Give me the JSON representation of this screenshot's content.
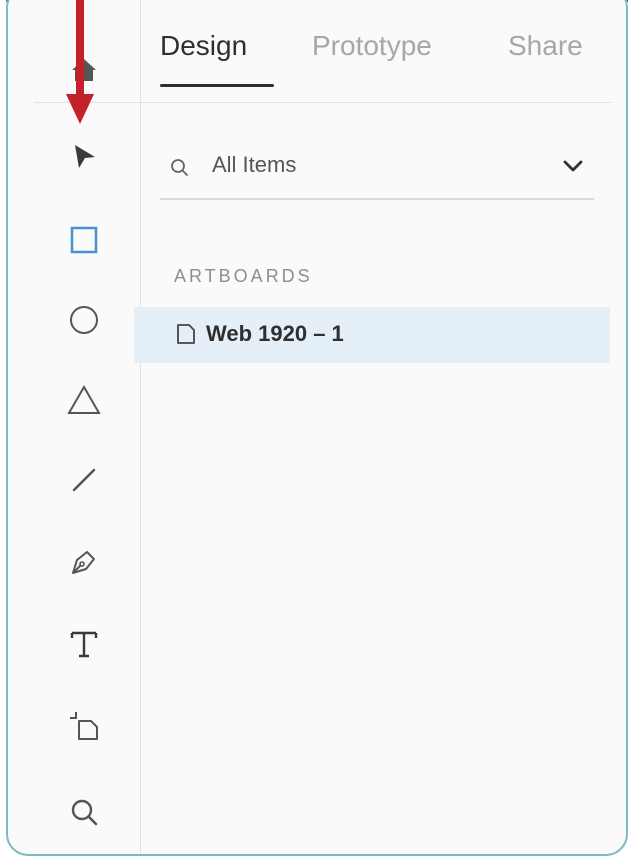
{
  "tabs": [
    {
      "label": "Design",
      "active": true
    },
    {
      "label": "Prototype",
      "active": false
    },
    {
      "label": "Share",
      "active": false
    }
  ],
  "search": {
    "label": "All Items"
  },
  "section": {
    "header": "ARTBOARDS"
  },
  "artboards": [
    {
      "label": "Web 1920 – 1",
      "selected": true
    }
  ],
  "tools": [
    {
      "icon": "select-arrow-icon",
      "selected": true
    },
    {
      "icon": "rectangle-icon",
      "selected": false
    },
    {
      "icon": "ellipse-icon",
      "selected": false
    },
    {
      "icon": "polygon-icon",
      "selected": false
    },
    {
      "icon": "line-icon",
      "selected": false
    },
    {
      "icon": "pen-icon",
      "selected": false
    },
    {
      "icon": "text-icon",
      "selected": false
    },
    {
      "icon": "artboard-icon",
      "selected": false
    },
    {
      "icon": "zoom-icon",
      "selected": false
    }
  ],
  "colors": {
    "accent": "#4a90d9",
    "selected_row": "#e4eff7",
    "annotation_arrow": "#c4222a"
  }
}
